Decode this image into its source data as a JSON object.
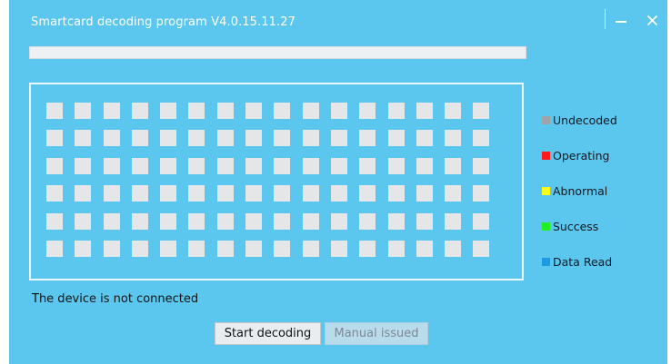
{
  "window": {
    "title": "Smartcard decoding program V4.0.15.11.27",
    "minimize_icon": "minimize-icon",
    "close_icon": "close-icon"
  },
  "progress": {
    "value": 0
  },
  "grid": {
    "rows": 6,
    "columns": 16,
    "cell_state": "Undecoded"
  },
  "legend": [
    {
      "label": "Undecoded",
      "color": "#a0a4a8"
    },
    {
      "label": "Operating",
      "color": "#ff1a1a"
    },
    {
      "label": "Abnormal",
      "color": "#ffff1a"
    },
    {
      "label": "Success",
      "color": "#22ee22"
    },
    {
      "label": "Data Read",
      "color": "#1e9be0"
    }
  ],
  "status": {
    "text": "The device is not connected"
  },
  "buttons": {
    "start_label": "Start decoding",
    "manual_label": "Manual issued"
  },
  "colors": {
    "window_bg": "#5bc7ee",
    "cell_bg": "#e4e6e8"
  }
}
